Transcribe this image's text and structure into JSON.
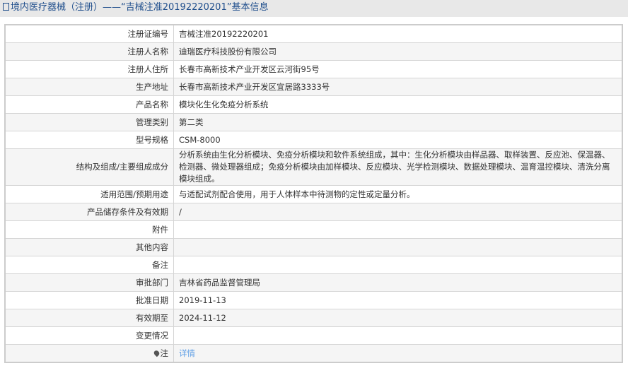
{
  "header": {
    "title": "境内医疗器械（注册）——“吉械注准20192220201”基本信息",
    "icon": "document-icon"
  },
  "rows": [
    {
      "label": "注册证编号",
      "value": "吉械注准20192220201"
    },
    {
      "label": "注册人名称",
      "value": "迪瑞医疗科技股份有限公司"
    },
    {
      "label": "注册人住所",
      "value": "长春市高新技术产业开发区云河街95号"
    },
    {
      "label": "生产地址",
      "value": "长春市高新技术产业开发区宜居路3333号"
    },
    {
      "label": "产品名称",
      "value": "模块化生化免疫分析系统"
    },
    {
      "label": "管理类别",
      "value": "第二类"
    },
    {
      "label": "型号规格",
      "value": "CSM-8000"
    },
    {
      "label": "结构及组成/主要组成成分",
      "value": "分析系统由生化分析模块、免疫分析模块和软件系统组成，其中：生化分析模块由样品器、取样装置、反应池、保温器、检测器、微处理器组成；免疫分析模块由加样模块、反应模块、光学检测模块、数据处理模块、温育温控模块、清洗分离模块组成。"
    },
    {
      "label": "适用范围/预期用途",
      "value": "与适配试剂配合使用，用于人体样本中待测物的定性或定量分析。"
    },
    {
      "label": "产品储存条件及有效期",
      "value": "/"
    },
    {
      "label": "附件",
      "value": ""
    },
    {
      "label": "其他内容",
      "value": ""
    },
    {
      "label": "备注",
      "value": ""
    },
    {
      "label": "审批部门",
      "value": "吉林省药品监督管理局"
    },
    {
      "label": "批准日期",
      "value": "2019-11-13"
    },
    {
      "label": "有效期至",
      "value": "2024-11-12"
    },
    {
      "label": "变更情况",
      "value": ""
    },
    {
      "label": "注",
      "value": "详情",
      "icon": "pin-icon"
    }
  ]
}
